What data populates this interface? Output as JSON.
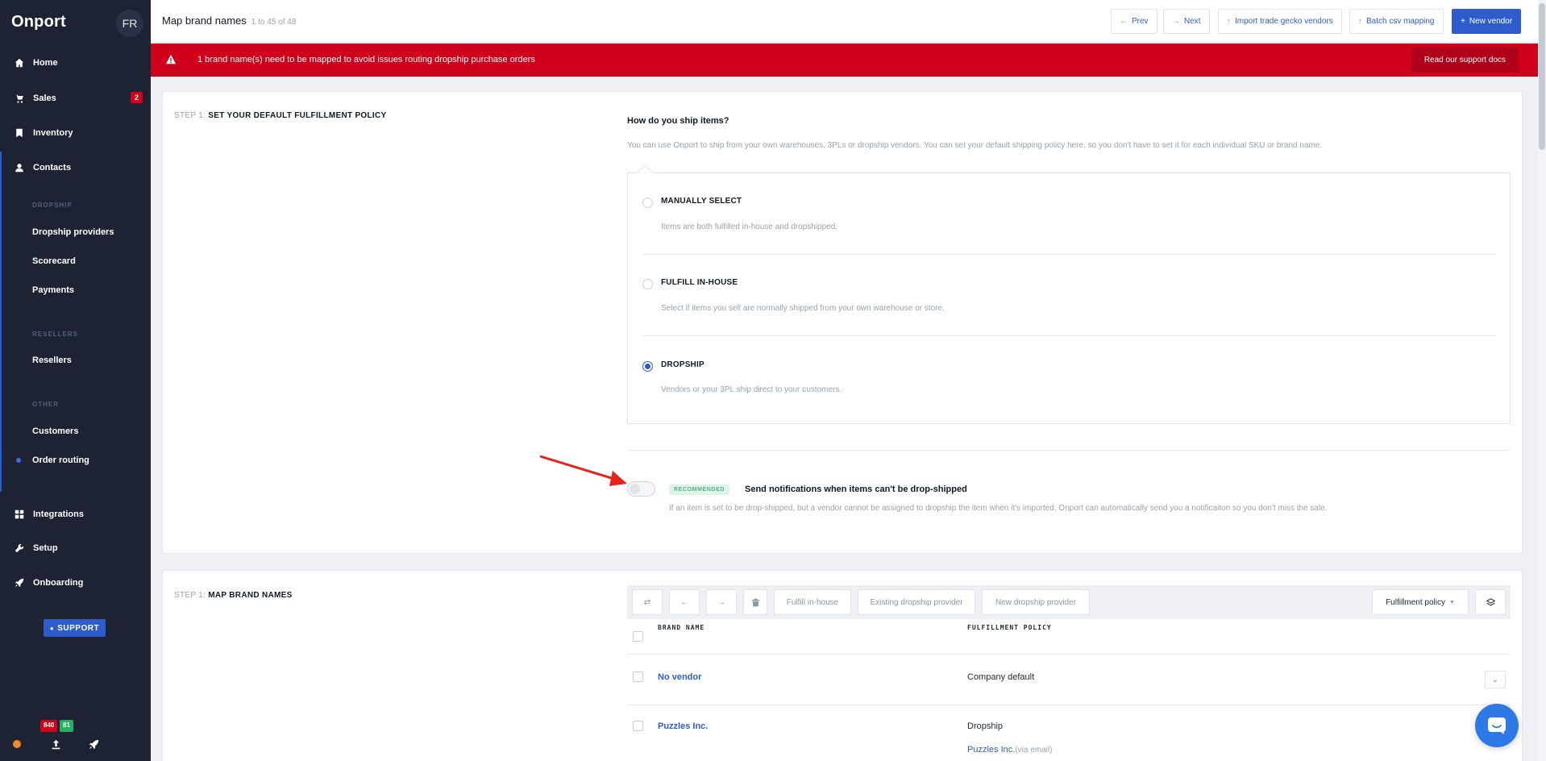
{
  "sidebar": {
    "brand": "Onport",
    "avatar": "FR",
    "nav": {
      "home": "Home",
      "sales": "Sales",
      "sales_badge": "2",
      "inventory": "Inventory",
      "contacts": "Contacts",
      "integrations": "Integrations",
      "setup": "Setup",
      "onboarding": "Onboarding"
    },
    "groups": {
      "dropship": "DROPSHIP",
      "resellers": "RESELLERS",
      "other": "OTHER"
    },
    "sub": {
      "dropship_providers": "Dropship providers",
      "scorecard": "Scorecard",
      "payments": "Payments",
      "resellers": "Resellers",
      "customers": "Customers",
      "order_routing": "Order routing"
    },
    "support": "SUPPORT",
    "badge_red": "840",
    "badge_green": "81"
  },
  "header": {
    "title": "Map brand names",
    "count": "1 to 45 of 48",
    "buttons": {
      "prev": "Prev",
      "next": "Next",
      "import": "Import trade gecko vendors",
      "batch": "Batch csv mapping",
      "new_vendor": "New vendor"
    }
  },
  "alert": {
    "text": "1 brand name(s) need to be mapped to avoid issues routing dropship purchase orders",
    "button": "Read our support docs"
  },
  "step1": {
    "label_prefix": "STEP 1:",
    "label": "SET YOUR DEFAULT FULFILLMENT POLICY",
    "question": "How do you ship items?",
    "description": "You can use Onport to ship from your own warehouses, 3PLs or dropship vendors. You can set your default shipping policy here, so you don't have to set it for each individual SKU or brand name.",
    "options": [
      {
        "title": "MANUALLY SELECT",
        "desc": "Items are both fulfilled in-house and dropshipped.",
        "selected": false
      },
      {
        "title": "FULFILL IN-HOUSE",
        "desc": "Select if items you sell are normally shipped from your own warehouse or store.",
        "selected": false
      },
      {
        "title": "DROPSHIP",
        "desc": "Vendors or your 3PL ship direct to your customers.",
        "selected": true
      }
    ],
    "recommended": "RECOMMENDED",
    "notif_title": "Send notifications when items can't be drop-shipped",
    "notif_desc": "If an item is set to be drop-shipped, but a vendor cannot be assigned to dropship the item when it's imported, Onport can automatically send you a notificaiton so you don't miss the sale.",
    "notif_enabled": false
  },
  "step2": {
    "label_prefix": "STEP 1:",
    "label": "MAP BRAND NAMES",
    "toolbar": {
      "fulfill_inhouse": "Fulfill in-house",
      "existing_provider": "Existing dropship provider",
      "new_provider": "New dropship provider",
      "policy_filter": "Fulfillment policy"
    },
    "columns": {
      "brand": "BRAND NAME",
      "policy": "FULFILLMENT POLICY"
    },
    "rows": [
      {
        "brand": "No vendor",
        "policy": "Company default"
      },
      {
        "brand": "Puzzles Inc.",
        "policy": "Dropship",
        "vendor": "Puzzles Inc.",
        "vendor_note": "(via email)"
      }
    ]
  }
}
